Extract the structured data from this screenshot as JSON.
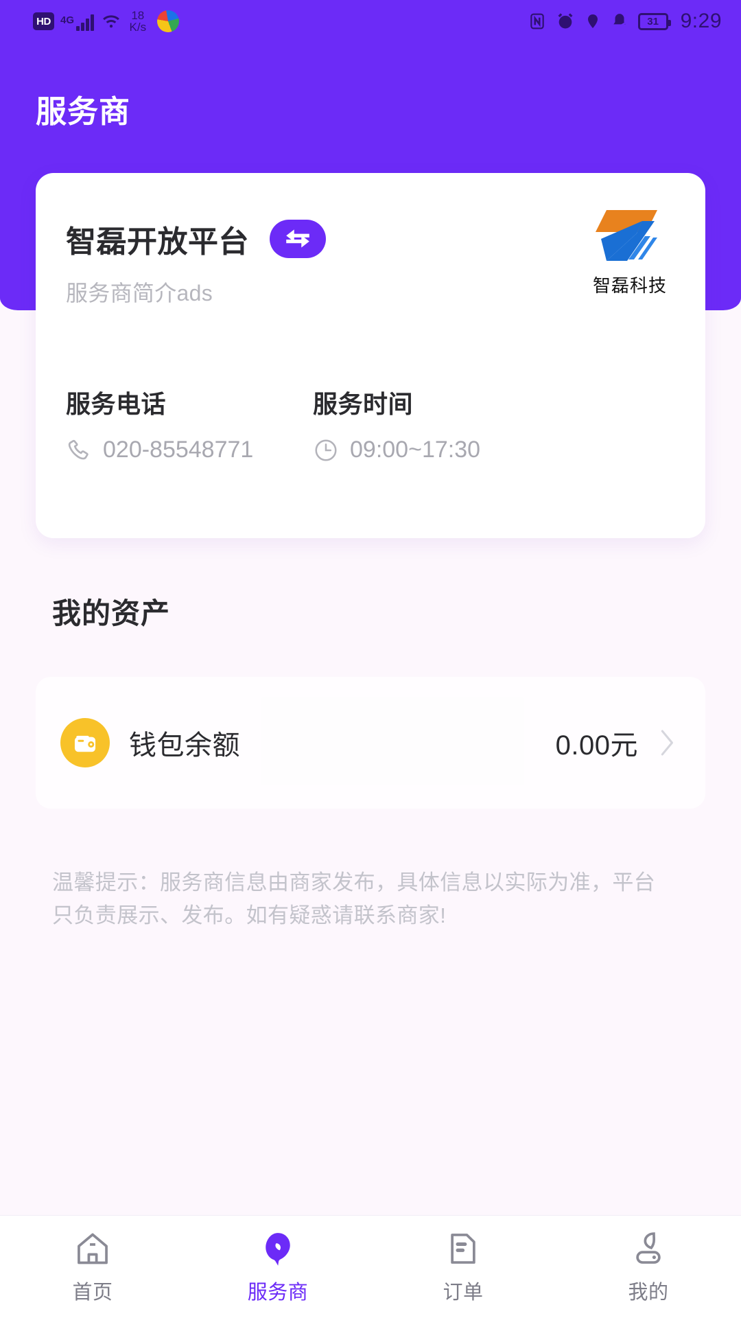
{
  "status_bar": {
    "hd_badge": "HD",
    "network_type": "4G",
    "wifi_icon": "wifi-icon",
    "speed_value": "18",
    "speed_unit": "K/s",
    "app_icon": "app-icon",
    "nfc_icon": "nfc-icon",
    "alarm_icon": "alarm-icon",
    "location_icon": "location-icon",
    "mute_icon": "bell-mute-icon",
    "battery_level": "31",
    "time": "9:29"
  },
  "header": {
    "title": "服务商",
    "background_color": "#6c2bf7"
  },
  "provider_card": {
    "name": "智磊开放平台",
    "switch_icon": "exchange-arrows-icon",
    "subtitle": "服务商简介ads",
    "brand_name": "智磊科技",
    "brand_colors": {
      "top": "#e8821e",
      "bottom": "#1a6fd4"
    },
    "phone": {
      "label": "服务电话",
      "icon": "phone-icon",
      "value": "020-85548771"
    },
    "hours": {
      "label": "服务时间",
      "icon": "clock-icon",
      "value": "09:00~17:30"
    }
  },
  "assets": {
    "title": "我的资产",
    "wallet": {
      "icon": "wallet-icon",
      "icon_color": "#f8c229",
      "label": "钱包余额",
      "amount": "0.00元",
      "chevron": "chevron-right-icon"
    }
  },
  "notice": {
    "text": "温馨提示：服务商信息由商家发布，具体信息以实际为准，平台只负责展示、发布。如有疑惑请联系商家!"
  },
  "tabbar": {
    "accent_color": "#6c2bf7",
    "items": [
      {
        "label": "首页",
        "icon": "home-icon",
        "active": false
      },
      {
        "label": "服务商",
        "icon": "service-bubble-icon",
        "active": true
      },
      {
        "label": "订单",
        "icon": "order-doc-icon",
        "active": false
      },
      {
        "label": "我的",
        "icon": "user-profile-icon",
        "active": false
      }
    ]
  }
}
